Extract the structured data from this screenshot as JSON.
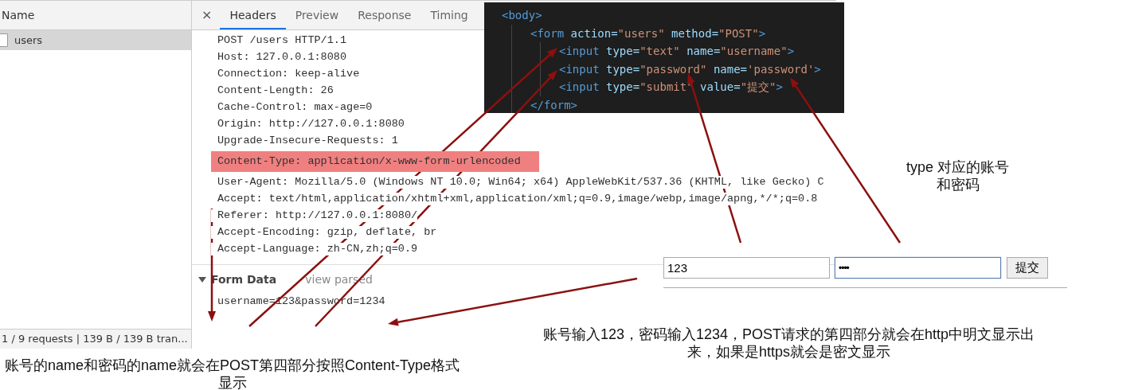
{
  "network_list": {
    "column_header": "Name",
    "rows": [
      {
        "name": "users",
        "selected": true
      }
    ],
    "status_bar": "1 / 9 requests | 139 B / 139 B tran..."
  },
  "details": {
    "close": "×",
    "tabs": [
      {
        "label": "Headers",
        "selected": true
      },
      {
        "label": "Preview",
        "selected": false
      },
      {
        "label": "Response",
        "selected": false
      },
      {
        "label": "Timing",
        "selected": false
      }
    ],
    "request_headers": [
      {
        "text": "POST /users HTTP/1.1",
        "highlighted": false
      },
      {
        "text": "Host: 127.0.0.1:8080",
        "highlighted": false
      },
      {
        "text": "Connection: keep-alive",
        "highlighted": false
      },
      {
        "text": "Content-Length: 26",
        "highlighted": false
      },
      {
        "text": "Cache-Control: max-age=0",
        "highlighted": false
      },
      {
        "text": "Origin: http://127.0.0.1:8080",
        "highlighted": false
      },
      {
        "text": "Upgrade-Insecure-Requests: 1",
        "highlighted": false
      },
      {
        "text": "Content-Type: application/x-www-form-urlencoded",
        "highlighted": true
      },
      {
        "text": "User-Agent: Mozilla/5.0 (Windows NT 10.0; Win64; x64) AppleWebKit/537.36 (KHTML, like Gecko) C",
        "highlighted": false
      },
      {
        "text": "Accept: text/html,application/xhtml+xml,application/xml;q=0.9,image/webp,image/apng,*/*;q=0.8",
        "highlighted": false
      },
      {
        "text": "Referer: http://127.0.0.1:8080/",
        "highlighted": false
      },
      {
        "text": "Accept-Encoding: gzip, deflate, br",
        "highlighted": false
      },
      {
        "text": "Accept-Language: zh-CN,zh;q=0.9",
        "highlighted": false
      }
    ],
    "form_data": {
      "title": "Form Data",
      "expanded": true,
      "toggle": "view parsed",
      "lines": [
        "username=123&password=1234"
      ]
    }
  },
  "code": {
    "lines": [
      {
        "tokens": [
          {
            "kind": "tag",
            "text": "<body>"
          }
        ],
        "children": [
          {
            "tokens": [
              {
                "kind": "tag",
                "text": "<form"
              },
              {
                "kind": "attr",
                "text": "action="
              },
              {
                "kind": "string",
                "text": "\"users\""
              },
              {
                "kind": "attr",
                "text": "method="
              },
              {
                "kind": "string",
                "text": "\"POST\""
              },
              {
                "kind": "tag",
                "text": ">"
              }
            ],
            "children": [
              {
                "tokens": [
                  {
                    "kind": "tag",
                    "text": "<input"
                  },
                  {
                    "kind": "attr",
                    "text": "type="
                  },
                  {
                    "kind": "string",
                    "text": "\"text\""
                  },
                  {
                    "kind": "attr",
                    "text": "name="
                  },
                  {
                    "kind": "string",
                    "text": "\"username\""
                  },
                  {
                    "kind": "tag",
                    "text": ">"
                  }
                ]
              },
              {
                "tokens": [
                  {
                    "kind": "tag",
                    "text": "<input"
                  },
                  {
                    "kind": "attr",
                    "text": "type="
                  },
                  {
                    "kind": "string",
                    "text": "\"password\""
                  },
                  {
                    "kind": "attr",
                    "text": "name="
                  },
                  {
                    "kind": "string",
                    "text": "'password'"
                  },
                  {
                    "kind": "tag",
                    "text": ">"
                  }
                ]
              },
              {
                "tokens": [
                  {
                    "kind": "tag",
                    "text": "<input"
                  },
                  {
                    "kind": "attr",
                    "text": "type="
                  },
                  {
                    "kind": "string",
                    "text": "\"submit\""
                  },
                  {
                    "kind": "attr",
                    "text": "value="
                  },
                  {
                    "kind": "string",
                    "text": "\"提交\""
                  },
                  {
                    "kind": "tag",
                    "text": ">"
                  }
                ]
              }
            ],
            "closing": [
              {
                "kind": "tag",
                "text": "</form>"
              }
            ]
          }
        ]
      }
    ]
  },
  "form_demo": {
    "fields": [
      {
        "kind": "text",
        "value": "123",
        "focused": false
      },
      {
        "kind": "password",
        "value": "••••",
        "focused": true
      }
    ],
    "submit": "提交"
  },
  "annotations": [
    {
      "kind": "type_note",
      "lines": [
        "type 对应的账号",
        "和密码"
      ]
    },
    {
      "kind": "name_note",
      "lines": [
        "账号的name和密码的name就会在POST第四部分按照Content-Type格式",
        "显示"
      ]
    },
    {
      "kind": "http_note",
      "lines": [
        "账号输入123，密码输入1234，POST请求的第四部分就会在http中明文显示出",
        "来，如果是https就会是密文显示"
      ]
    }
  ]
}
